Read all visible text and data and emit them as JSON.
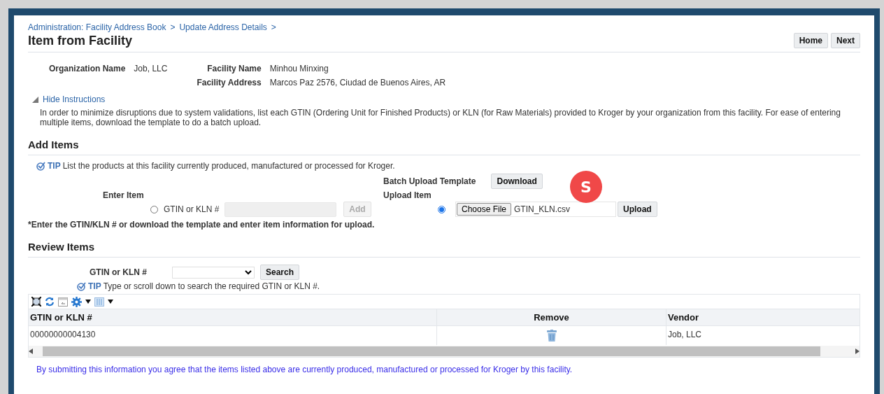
{
  "breadcrumbs": {
    "items": [
      "Administration: Facility Address Book",
      "Update Address Details"
    ],
    "separator": ">"
  },
  "title": "Item from Facility",
  "buttons": [
    "Home",
    "Next"
  ],
  "details": [
    {
      "label": "Organization Name",
      "value": "Job, LLC"
    },
    {
      "label": "Facility Name",
      "value": "Minhou Minxing"
    },
    {
      "label": "Facility Address",
      "value": "Marcos Paz 2576, Ciudad de Buenos Aires, AR"
    }
  ],
  "instructions": {
    "toggle": "Hide Instructions",
    "expanded": true,
    "text": "In order to minimize disruptions due to system validations, list each GTIN (Ordering Unit for Finished Products) or KLN (for Raw Materials) provided to Kroger by your organization from this facility. For ease of entering multiple items, download the template to do a batch upload."
  },
  "add_items": {
    "heading": "Add Items",
    "tip": {
      "label": "TIP",
      "text": "List the products at this facility currently produced, manufactured or processed for Kroger."
    },
    "enter_item": {
      "label": "Enter Item",
      "radio": {
        "label": "GTIN or KLN #",
        "selected": false
      },
      "add_button": {
        "label": "Add",
        "disabled": true
      }
    },
    "batch_template": {
      "label": "Batch Upload Template",
      "button": "Download"
    },
    "upload_item": {
      "label": "Upload Item",
      "radio": {
        "selected": true
      },
      "choose_button": "Choose File",
      "file_name": "GTIN_KLN.csv",
      "upload_button": "Upload"
    },
    "marker": {
      "label": "S",
      "color": "#f04848"
    },
    "note": "*Enter the GTIN/KLN # or download the template and enter item information for upload."
  },
  "review_items": {
    "heading": "Review Items",
    "search": {
      "label": "GTIN or KLN #",
      "button": "Search"
    },
    "tip": {
      "label": "TIP",
      "text": "Type or scroll down to search the required GTIN or KLN #."
    },
    "table": {
      "columns": [
        "GTIN or KLN #",
        "Remove",
        "Vendor"
      ],
      "rows": [
        {
          "gtin": "00000000004130",
          "vendor": "Job, LLC"
        }
      ]
    }
  },
  "footer": "By submitting this information you agree that the items listed above are currently produced, manufactured or processed for Kroger by this facility."
}
